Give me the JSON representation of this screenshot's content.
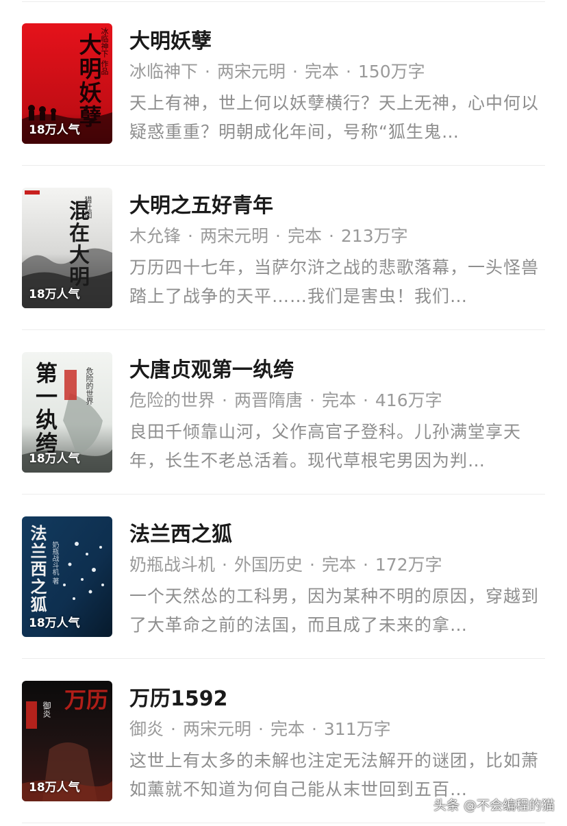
{
  "books": [
    {
      "title": "大明妖孽",
      "author": "冰临神下",
      "category": "两宋元明",
      "status": "完本",
      "word_count": "150万字",
      "description": "天上有神，世上何以妖孽横行？天上无神，心中何以疑惑重重？明朝成化年间，号称“狐生鬼…",
      "popularity": "18万人气",
      "cover_text": "大明妖孽",
      "cover_subtext": "冰临神下 作品"
    },
    {
      "title": "大明之五好青年",
      "author": "木允锋",
      "category": "两宋元明",
      "status": "完本",
      "word_count": "213万字",
      "description": "万历四十七年，当萨尔浒之战的悲歌落幕，一头怪兽踏上了战争的天平……我们是害虫！我们…",
      "popularity": "18万人气",
      "cover_text": "混在大明",
      "cover_subtext": "猎社团"
    },
    {
      "title": "大唐贞观第一纨绔",
      "author": "危险的世界",
      "category": "两晋隋唐",
      "status": "完本",
      "word_count": "416万字",
      "description": "良田千倾靠山河，父作高官子登科。儿孙满堂享天年，长生不老总活着。现代草根宅男因为判…",
      "popularity": "18万人气",
      "cover_text": "第一纨绔",
      "cover_subtext": "危险的世界"
    },
    {
      "title": "法兰西之狐",
      "author": "奶瓶战斗机",
      "category": "外国历史",
      "status": "完本",
      "word_count": "172万字",
      "description": "一个天然怂的工科男，因为某种不明的原因，穿越到了大革命之前的法国，而且成了未来的拿…",
      "popularity": "18万人气",
      "cover_text": "法兰西之狐",
      "cover_subtext": "奶瓶战斗机 著"
    },
    {
      "title": "万历1592",
      "author": "御炎",
      "category": "两宋元明",
      "status": "完本",
      "word_count": "311万字",
      "description": "这世上有太多的未解也注定无法解开的谜团，比如萧如薰就不知道为何自己能从末世回到五百…",
      "popularity": "18万人气",
      "cover_text": "万历",
      "cover_subtext": "御炎"
    }
  ],
  "separator": "·",
  "watermark": "头条 @不会编程的猫",
  "colors": {
    "title": "#1a1a1a",
    "meta": "#9a9a9a",
    "description": "#8e8e8e",
    "divider": "#ececec"
  }
}
